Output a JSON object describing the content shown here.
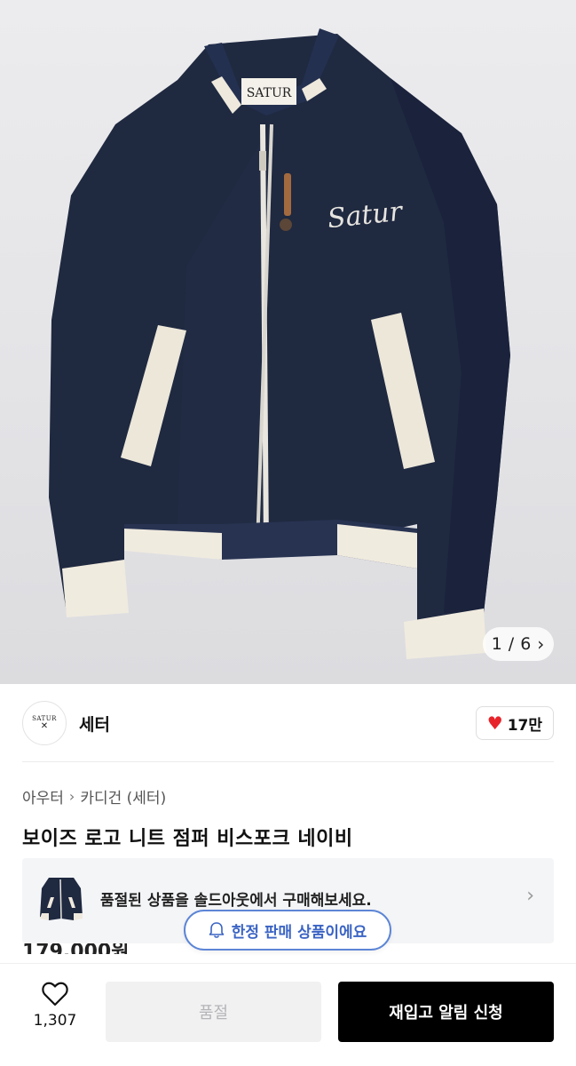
{
  "gallery": {
    "current": "1",
    "separator": "/",
    "total": "6",
    "next_icon": "chevron-right-icon",
    "image_logo_text": "SATUR",
    "image_script_text": "Satur"
  },
  "brand": {
    "logo_text": "SATUR",
    "name": "세터",
    "like_count": "17만",
    "like_icon": "heart-filled-icon",
    "like_color": "#e8242b"
  },
  "breadcrumb": {
    "items": [
      "아우터",
      "카디건 (세터)"
    ],
    "separator_icon": "chevron-right-icon"
  },
  "product": {
    "title": "보이즈 로고 니트 점퍼 비스포크 네이비",
    "price_partial": "179,000원"
  },
  "soldout_banner": {
    "text": "품절된 상품을 솔드아웃에서 구매해보세요.",
    "chevron_icon": "chevron-right-icon"
  },
  "limited_notice": {
    "text": "한정 판매 상품이에요",
    "icon": "bell-icon",
    "accent_color": "#3b64c4"
  },
  "bottom_bar": {
    "wish_icon": "heart-outline-icon",
    "wish_count": "1,307",
    "soldout_label": "품절",
    "restock_label": "재입고 알림 신청"
  }
}
